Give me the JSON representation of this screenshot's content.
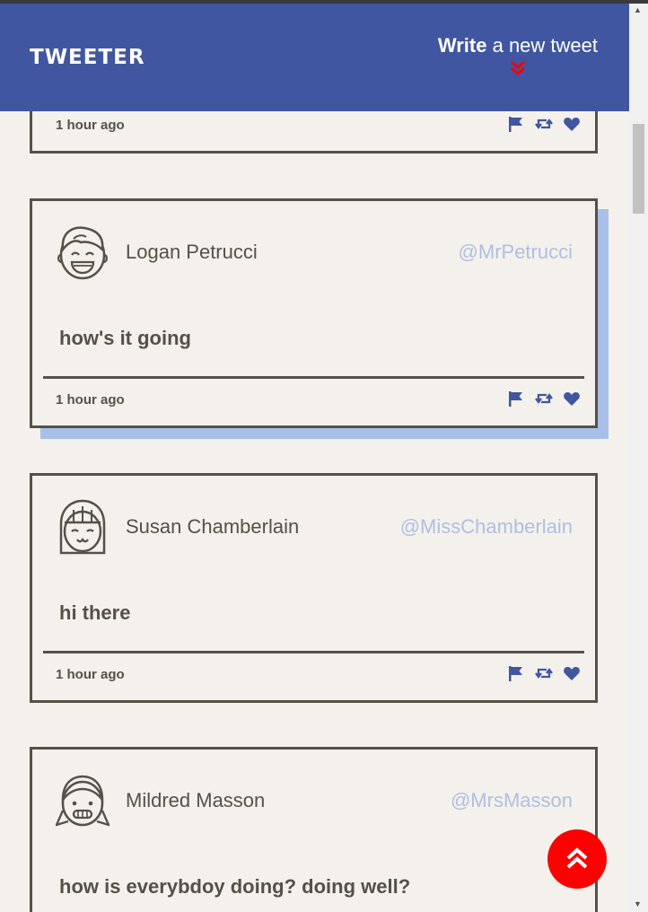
{
  "app": {
    "brand": "TWEETER"
  },
  "compose": {
    "bold": "Write",
    "rest": " a new tweet"
  },
  "tweets": [
    {
      "time": "1 hour ago"
    },
    {
      "name": "Logan Petrucci",
      "handle": "@MrPetrucci",
      "text": "how's it going",
      "time": "1 hour ago"
    },
    {
      "name": "Susan Chamberlain",
      "handle": "@MissChamberlain",
      "text": "hi there",
      "time": "1 hour ago"
    },
    {
      "name": "Mildred Masson",
      "handle": "@MrsMasson",
      "text": "how is everybdoy doing? doing well?"
    }
  ],
  "icons": {
    "compose_arrow": "double-chevron-down-icon",
    "flag": "flag-icon",
    "retweet": "retweet-icon",
    "like": "heart-icon",
    "back_to_top": "double-chevron-up-icon"
  },
  "colors": {
    "header": "#4056a1",
    "background": "#f4f1ec",
    "border": "#545149",
    "handle": "#aebfe3",
    "accent": "#ff0000",
    "highlight_shadow": "#a9bfe8"
  }
}
